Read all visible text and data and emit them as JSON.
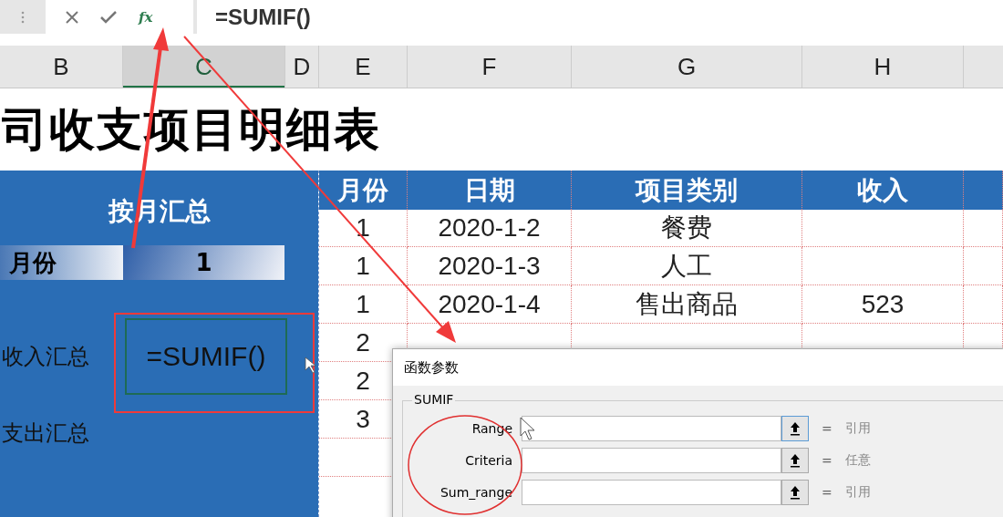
{
  "formula_bar": {
    "function_label": "fx",
    "formula": "=SUMIF()"
  },
  "columns": [
    {
      "label": "B",
      "selected": false
    },
    {
      "label": "C",
      "selected": true
    },
    {
      "label": "D",
      "selected": false
    },
    {
      "label": "E",
      "selected": false
    },
    {
      "label": "F",
      "selected": false
    },
    {
      "label": "G",
      "selected": false
    },
    {
      "label": "H",
      "selected": false
    }
  ],
  "sheet_title": "司收支项目明细表",
  "summary_panel": {
    "title": "按月汇总",
    "month_label": "月份",
    "month_value": "1",
    "rows": [
      {
        "label": "收入汇总",
        "value": "=SUMIF()",
        "active": true
      },
      {
        "label": "支出汇总"
      }
    ]
  },
  "table": {
    "headers": [
      "月份",
      "日期",
      "项目类别",
      "收入"
    ],
    "rows": [
      [
        "1",
        "2020-1-2",
        "餐费"
      ],
      [
        "1",
        "2020-1-3",
        "人工"
      ],
      [
        "1",
        "2020-1-4",
        "售出商品",
        "523"
      ],
      [
        "2"
      ],
      [
        "2"
      ],
      [
        "3"
      ]
    ]
  },
  "dialog": {
    "title": "函数参数",
    "function_name": "SUMIF",
    "arguments": [
      {
        "label": "Range",
        "equals": "=",
        "result": "引用"
      },
      {
        "label": "Criteria",
        "equals": "=",
        "result": "任意"
      },
      {
        "label": "Sum_range",
        "equals": "=",
        "result": "引用"
      }
    ]
  }
}
